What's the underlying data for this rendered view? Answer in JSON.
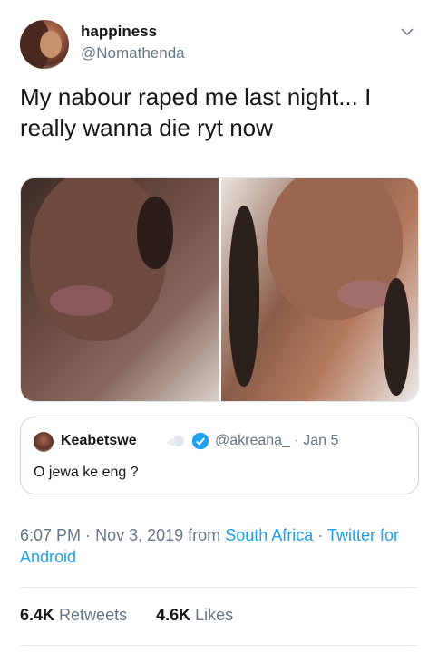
{
  "author": {
    "display_name": "happiness",
    "handle": "@Nomathenda"
  },
  "tweet": {
    "text": "My nabour raped me last night... I really wanna die ryt now"
  },
  "icons": {
    "more": "chevron-down-icon",
    "verified": "verified-badge-icon",
    "name_emoji": "dash-emoji-icon"
  },
  "quoted_tweet": {
    "display_name": "Keabetswe",
    "handle": "@akreana_",
    "separator": "·",
    "date": "Jan 5",
    "text": "O jewa ke eng ?"
  },
  "meta": {
    "time": "6:07 PM",
    "sep1": "·",
    "date": "Nov 3, 2019",
    "from": "from",
    "location": "South Africa",
    "sep2": "·",
    "client": "Twitter for Android"
  },
  "stats": {
    "retweets_count": "6.4K",
    "retweets_label": "Retweets",
    "likes_count": "4.6K",
    "likes_label": "Likes"
  },
  "colors": {
    "link": "#1da1f2",
    "secondary_text": "#657786",
    "primary_text": "#14171a"
  }
}
